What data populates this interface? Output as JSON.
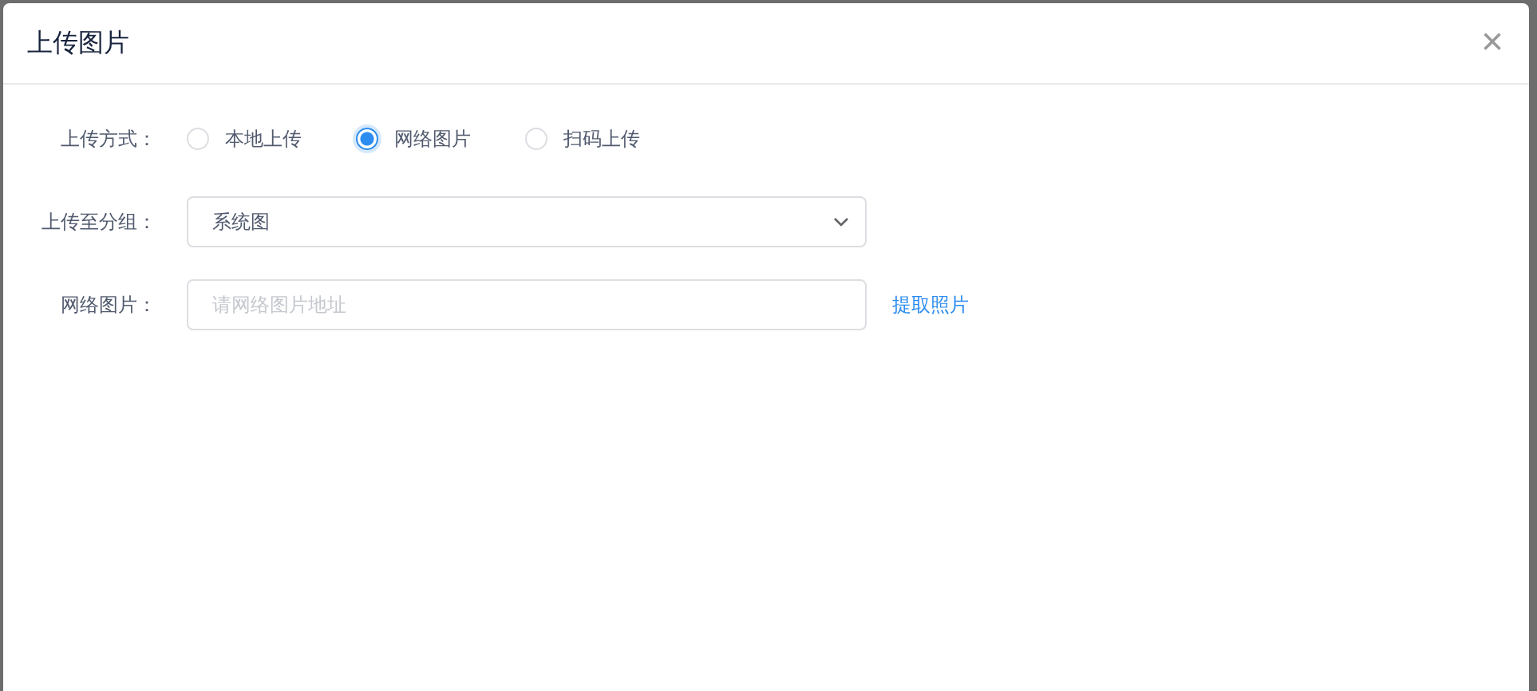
{
  "dialog": {
    "title": "上传图片",
    "close": "×"
  },
  "upload_method": {
    "label": "上传方式：",
    "options": [
      {
        "label": "本地上传",
        "selected": false
      },
      {
        "label": "网络图片",
        "selected": true
      },
      {
        "label": "扫码上传",
        "selected": false
      }
    ]
  },
  "group": {
    "label": "上传至分组：",
    "value": "系统图"
  },
  "network_image": {
    "label": "网络图片：",
    "placeholder": "请网络图片地址",
    "action": "提取照片"
  }
}
